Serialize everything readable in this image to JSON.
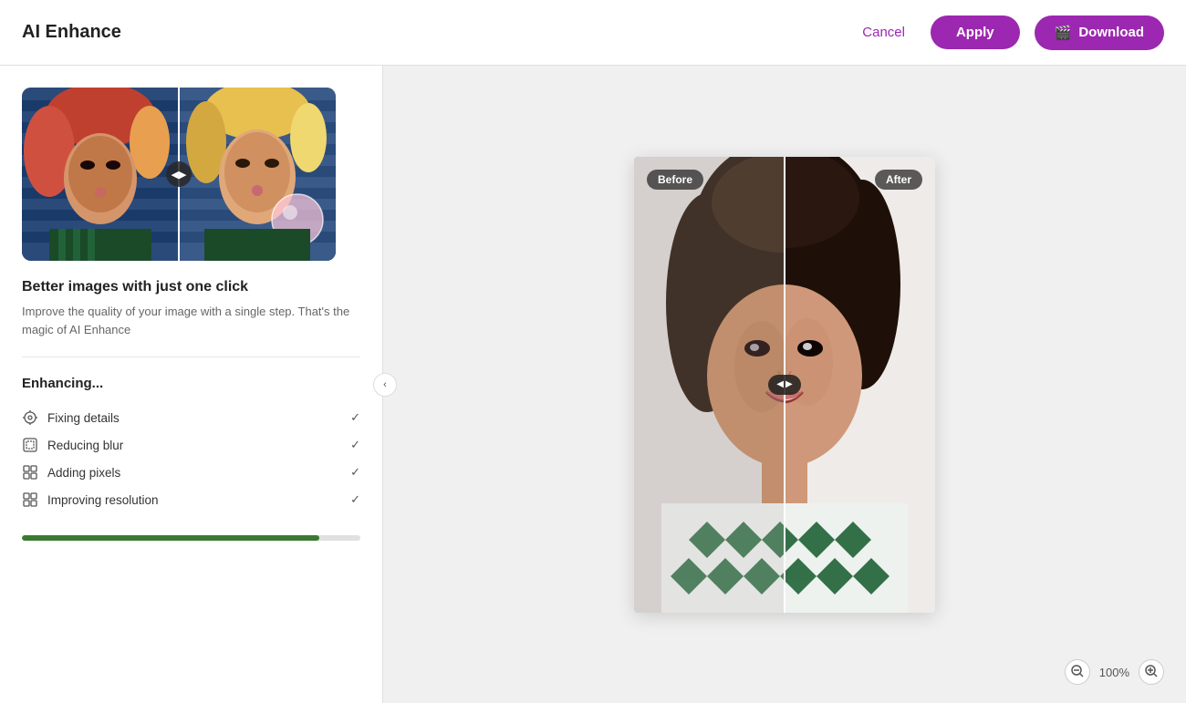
{
  "header": {
    "title": "AI Enhance",
    "cancel_label": "Cancel",
    "apply_label": "Apply",
    "download_label": "Download"
  },
  "left_panel": {
    "desc_title": "Better images with just one click",
    "desc_text": "Improve the quality of your image with a single step. That's the magic of AI Enhance",
    "enhancing_title": "Enhancing...",
    "enhance_items": [
      {
        "label": "Fixing details",
        "done": true
      },
      {
        "label": "Reducing blur",
        "done": true
      },
      {
        "label": "Adding pixels",
        "done": true
      },
      {
        "label": "Improving resolution",
        "done": true
      }
    ],
    "progress_percent": 88,
    "collapse_icon": "‹"
  },
  "comparison": {
    "before_label": "Before",
    "after_label": "After"
  },
  "zoom": {
    "zoom_out_icon": "zoom-out",
    "level": "100%",
    "zoom_in_icon": "zoom-in"
  }
}
